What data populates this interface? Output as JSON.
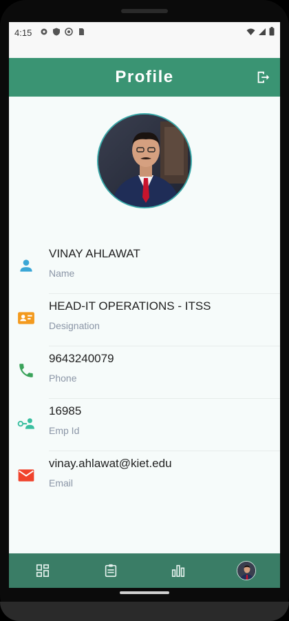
{
  "status_bar": {
    "time": "4:15",
    "left_icons": [
      "gear-icon",
      "shield-icon",
      "at-icon",
      "sim-icon"
    ],
    "right_icons": [
      "wifi-icon",
      "signal-icon",
      "battery-icon"
    ]
  },
  "app_bar": {
    "title": "Profile",
    "action_icon": "logout-icon"
  },
  "profile": {
    "fields": [
      {
        "value": "VINAY AHLAWAT",
        "label": "Name",
        "icon": "person-icon",
        "icon_color": "#3aa6d6"
      },
      {
        "value": "HEAD-IT OPERATIONS - ITSS",
        "label": "Designation",
        "icon": "badge-icon",
        "icon_color": "#f39a1e"
      },
      {
        "value": "9643240079",
        "label": "Phone",
        "icon": "phone-icon",
        "icon_color": "#3aa35a"
      },
      {
        "value": "16985",
        "label": "Emp Id",
        "icon": "key-person-icon",
        "icon_color": "#3bbfa0"
      },
      {
        "value": "vinay.ahlawat@kiet.edu",
        "label": "Email",
        "icon": "mail-icon",
        "icon_color": "#f0432c"
      }
    ]
  },
  "bottom_nav": {
    "items": [
      "dashboard-icon",
      "assignment-icon",
      "bar-chart-icon",
      "profile-avatar"
    ],
    "active": "profile-avatar"
  },
  "colors": {
    "primary": "#3a9473",
    "bottom_nav": "#3a7d66",
    "screen_bg": "#f6fbfa"
  }
}
